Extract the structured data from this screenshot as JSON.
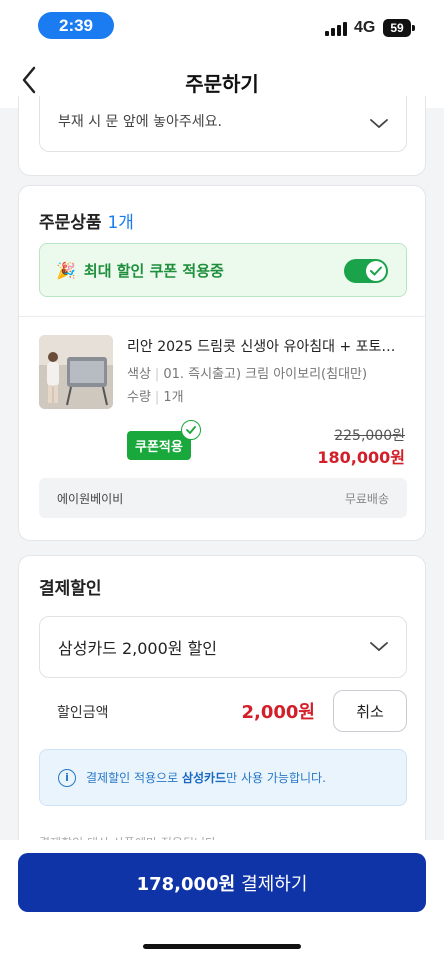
{
  "status": {
    "time": "2:39",
    "network": "4G",
    "battery": "59"
  },
  "header": {
    "title": "주문하기"
  },
  "delivery_request": {
    "value": "부재 시 문 앞에 놓아주세요."
  },
  "products": {
    "title": "주문상품",
    "count": "1개",
    "coupon_banner": {
      "emoji": "🎉",
      "label": "최대 할인 쿠폰 적용중",
      "toggle_on": true
    },
    "item": {
      "name": "리안 2025 드림콧 신생아 유아침대 + 포토…",
      "option_label": "색상",
      "option_value": "01. 즉시출고) 크림 아이보리(침대만)",
      "qty_label": "수량",
      "qty_value": "1개",
      "coupon_badge": "쿠폰적용",
      "price_original": "225,000원",
      "price_sale": "180,000원"
    },
    "seller": {
      "name": "에이원베이비",
      "shipping": "무료배송"
    }
  },
  "payment_discount": {
    "title": "결제할인",
    "selected_card": "삼성카드 2,000원 할인",
    "amount_label": "할인금액",
    "amount": "2,000원",
    "cancel_label": "취소",
    "info_pre": "결제할인 적용으로 ",
    "info_bold": "삼성카드",
    "info_post": "만 사용 가능합니다.",
    "note_cut": "결제할인 대상 상품에만 적용됩니다."
  },
  "checkout": {
    "amount": "178,000원",
    "label": "결제하기"
  },
  "colors": {
    "accent_blue": "#1a7cf0",
    "pay_button": "#0f34a8",
    "sale_red": "#d21f2a",
    "coupon_green": "#18a83b"
  }
}
